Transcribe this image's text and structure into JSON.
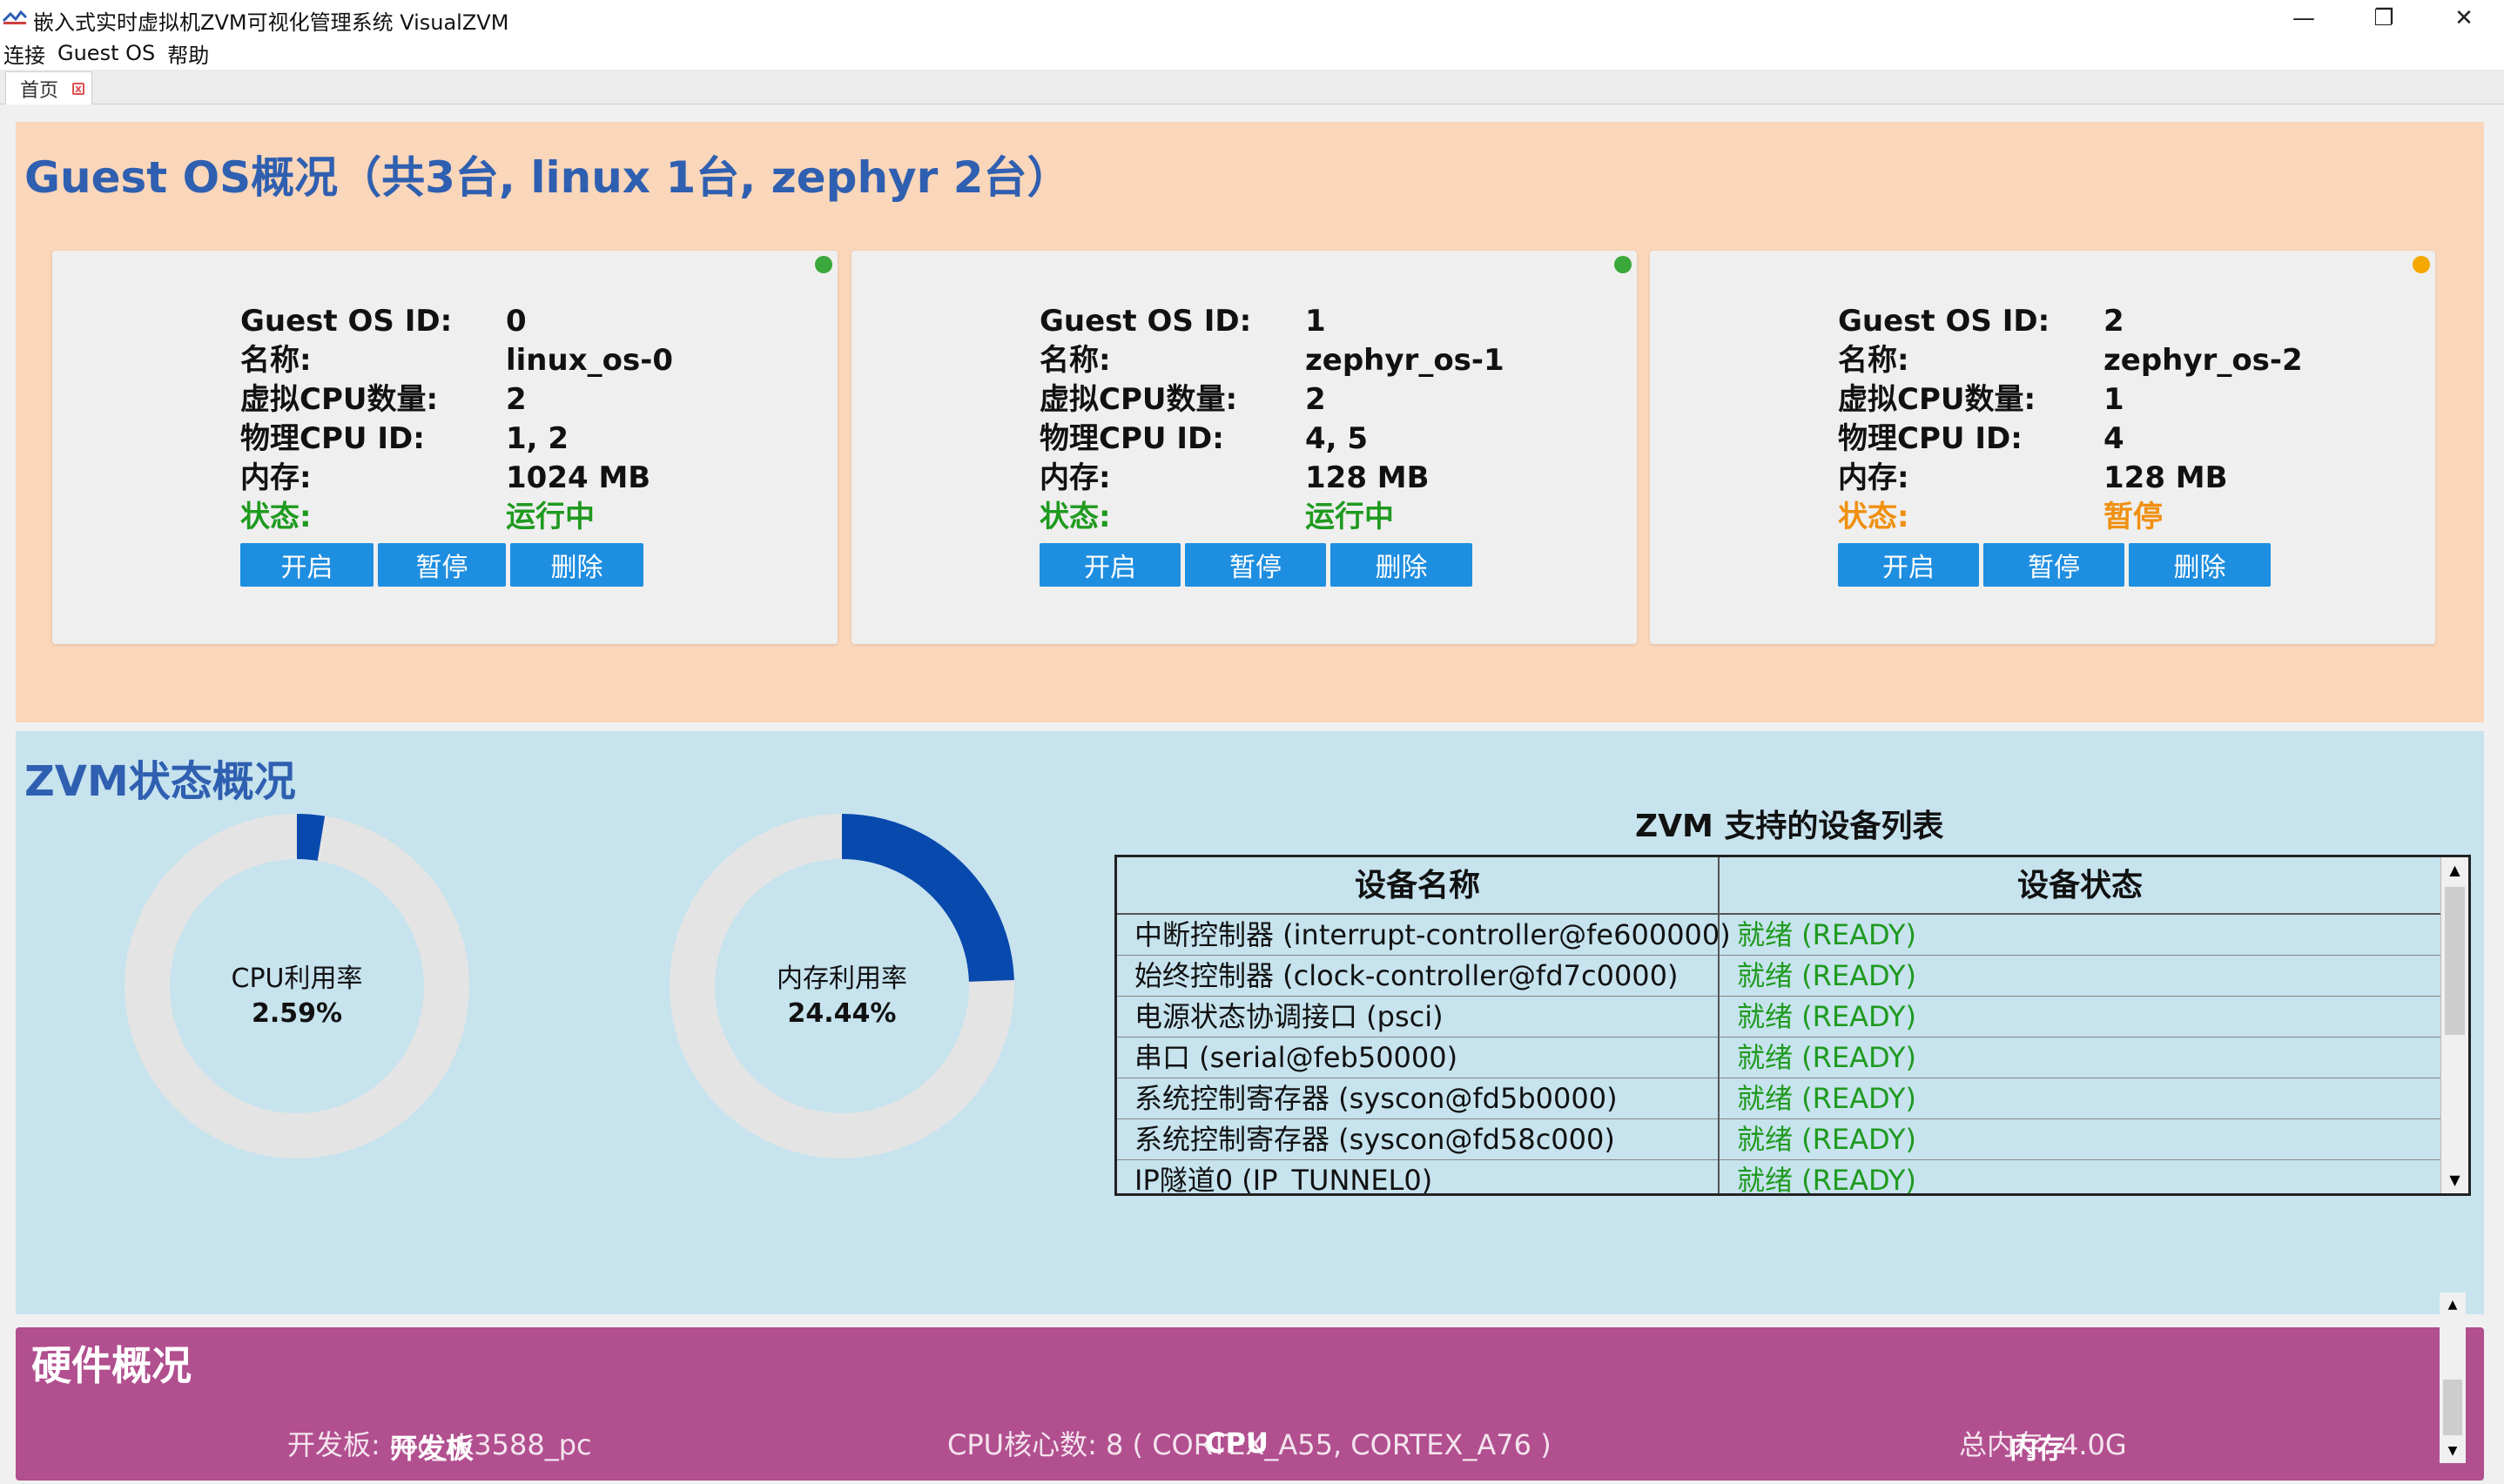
{
  "window": {
    "title": "嵌入式实时虚拟机ZVM可视化管理系统 VisualZVM",
    "controls": {
      "minimize": "—",
      "restore": "❐",
      "close": "✕"
    }
  },
  "menu": [
    "连接",
    "Guest OS",
    "帮助"
  ],
  "tabs": [
    {
      "label": "首页",
      "close": "x"
    }
  ],
  "guest_section": {
    "title": "Guest OS概况（共3台, linux 1台, zephyr 2台）",
    "labels": {
      "id": "Guest OS ID:",
      "name": "名称:",
      "vcpu": "虚拟CPU数量:",
      "pcpu": "物理CPU ID:",
      "mem": "内存:",
      "status": "状态:"
    },
    "buttons": {
      "start": "开启",
      "pause": "暂停",
      "delete": "删除"
    },
    "guests": [
      {
        "id": "0",
        "name": "linux_os-0",
        "vcpu": "2",
        "pcpu": "1, 2",
        "mem": "1024 MB",
        "status": "运行中",
        "status_color": "#1f9a1f",
        "dot_color": "#3aa83a"
      },
      {
        "id": "1",
        "name": "zephyr_os-1",
        "vcpu": "2",
        "pcpu": "4, 5",
        "mem": "128 MB",
        "status": "运行中",
        "status_color": "#1f9a1f",
        "dot_color": "#3aa83a"
      },
      {
        "id": "2",
        "name": "zephyr_os-2",
        "vcpu": "1",
        "pcpu": "4",
        "mem": "128 MB",
        "status": "暂停",
        "status_color": "#f09010",
        "dot_color": "#f4a800"
      }
    ]
  },
  "zvm_section": {
    "title": "ZVM状态概况",
    "cpu": {
      "label": "CPU利用率",
      "value": "2.59%",
      "fraction": 0.0259
    },
    "memory": {
      "label": "内存利用率",
      "value": "24.44%",
      "fraction": 0.2444
    },
    "device_table": {
      "title": "ZVM 支持的设备列表",
      "headers": [
        "设备名称",
        "设备状态"
      ],
      "rows": [
        [
          "中断控制器 (interrupt-controller@fe600000)",
          "就绪 (READY)"
        ],
        [
          "始终控制器 (clock-controller@fd7c0000)",
          "就绪 (READY)"
        ],
        [
          "电源状态协调接口 (psci)",
          "就绪 (READY)"
        ],
        [
          "串口 (serial@feb50000)",
          "就绪 (READY)"
        ],
        [
          "系统控制寄存器 (syscon@fd5b0000)",
          "就绪 (READY)"
        ],
        [
          "系统控制寄存器 (syscon@fd58c000)",
          "就绪 (READY)"
        ],
        [
          "IP隧道0 (IP_TUNNEL0)",
          "就绪 (READY)"
        ]
      ]
    },
    "colors": {
      "ring_bg": "#e4e4e4",
      "ring_fg": "#0849ad"
    }
  },
  "hardware_section": {
    "title": "硬件概况",
    "board": "开发板: roc_rk3588_pc",
    "cpu": "CPU核心数: 8 ( CORTEX_A55, CORTEX_A76 )",
    "mem": "总内存: 4.0G",
    "labels": [
      "开发板",
      "CPU",
      "内存"
    ]
  }
}
